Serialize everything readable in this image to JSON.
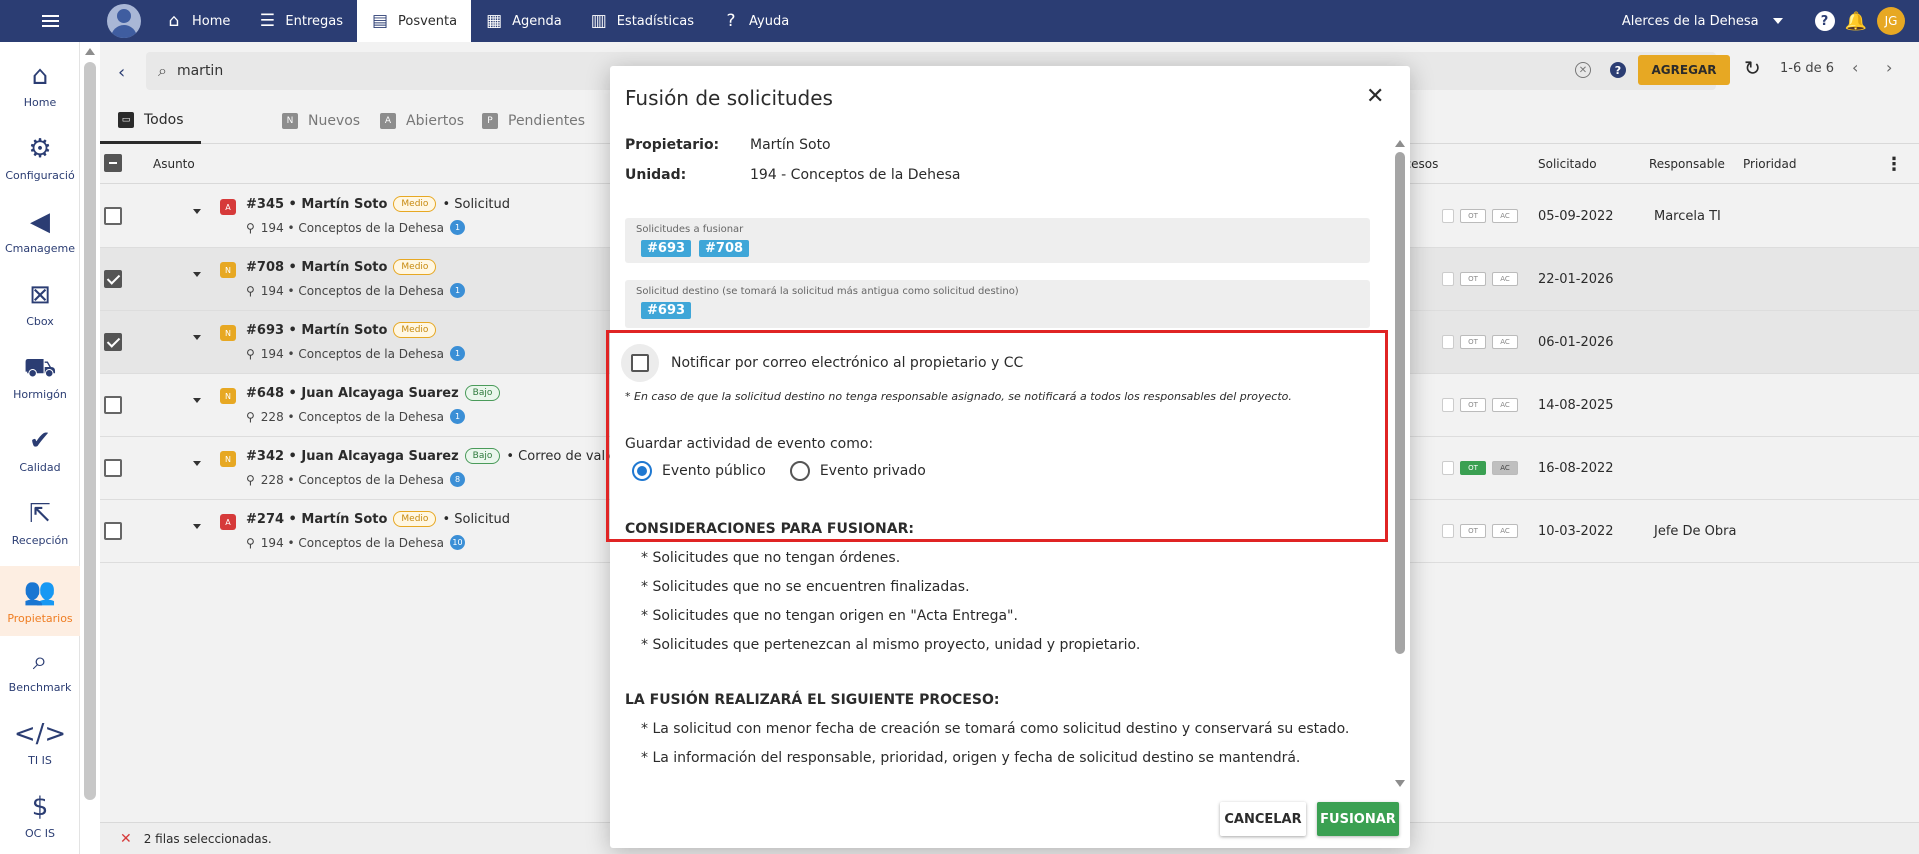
{
  "topnav": {
    "items": [
      {
        "label": "Home",
        "icon": "home-icon"
      },
      {
        "label": "Entregas",
        "icon": "list-icon"
      },
      {
        "label": "Posventa",
        "icon": "document-icon",
        "active": true
      },
      {
        "label": "Agenda",
        "icon": "calendar-icon"
      },
      {
        "label": "Estadísticas",
        "icon": "chart-icon"
      },
      {
        "label": "Ayuda",
        "icon": "help-icon"
      }
    ],
    "project": "Alerces de la Dehesa",
    "user_initials": "JG"
  },
  "sidebar": {
    "items": [
      {
        "label": "Home"
      },
      {
        "label": "Configuració"
      },
      {
        "label": "Cmanageme"
      },
      {
        "label": "Cbox"
      },
      {
        "label": "Hormigón"
      },
      {
        "label": "Calidad"
      },
      {
        "label": "Recepción"
      },
      {
        "label": "Propietarios",
        "active": true
      },
      {
        "label": "Benchmark"
      },
      {
        "label": "TI IS"
      },
      {
        "label": "OC IS"
      }
    ]
  },
  "search": {
    "value": "martin"
  },
  "toolbar": {
    "add_label": "AGREGAR",
    "pager": "1-6 de 6"
  },
  "tabs": [
    {
      "label": "Todos",
      "badge": ""
    },
    {
      "label": "Nuevos",
      "badge": "N"
    },
    {
      "label": "Abiertos",
      "badge": "A"
    },
    {
      "label": "Pendientes",
      "badge": "P"
    }
  ],
  "table": {
    "headers": {
      "asunto": "Asunto",
      "estado": "ado de procesos",
      "solicitado": "Solicitado",
      "responsable": "Responsable",
      "prioridad": "Prioridad"
    },
    "rows": [
      {
        "prio": "A",
        "prio_color": "#d63a3a",
        "title": "#345 • Martín Soto",
        "level": "Medio",
        "extra": "• Solicitud",
        "unit": "194 • Conceptos de la Dehesa",
        "count": "1",
        "date": "05-09-2022",
        "resp": "Marcela TI",
        "checked": false
      },
      {
        "prio": "N",
        "prio_color": "#e7a823",
        "title": "#708 • Martín Soto",
        "level": "Medio",
        "extra": "",
        "unit": "194 • Conceptos de la Dehesa",
        "count": "1",
        "date": "22-01-2026",
        "resp": "",
        "checked": true
      },
      {
        "prio": "N",
        "prio_color": "#e7a823",
        "title": "#693 • Martín Soto",
        "level": "Medio",
        "extra": "",
        "unit": "194 • Conceptos de la Dehesa",
        "count": "1",
        "date": "06-01-2026",
        "resp": "",
        "checked": true
      },
      {
        "prio": "N",
        "prio_color": "#e7a823",
        "title": "#648 • Juan Alcayaga Suarez",
        "level": "Bajo",
        "extra": "",
        "unit": "228 • Conceptos de la Dehesa",
        "count": "1",
        "date": "14-08-2025",
        "resp": "",
        "checked": false
      },
      {
        "prio": "N",
        "prio_color": "#e7a823",
        "title": "#342 • Juan Alcayaga Suarez",
        "level": "Bajo",
        "extra": "• Correo de valid",
        "unit": "228 • Conceptos de la Dehesa",
        "count": "8",
        "date": "16-08-2022",
        "resp": "",
        "checked": false
      },
      {
        "prio": "A",
        "prio_color": "#d63a3a",
        "title": "#274 • Martín Soto",
        "level": "Medio",
        "extra": "• Solicitud",
        "unit": "194 • Conceptos de la Dehesa",
        "count": "10",
        "date": "10-03-2022",
        "resp": "Jefe De Obra",
        "checked": false
      }
    ],
    "tag_labels": {
      "ot": "OT",
      "ac": "AC"
    }
  },
  "footer": {
    "selected": "2 filas seleccionadas."
  },
  "modal": {
    "title": "Fusión de solicitudes",
    "owner_label": "Propietario:",
    "owner_value": "Martín Soto",
    "unit_label": "Unidad:",
    "unit_value": "194 - Conceptos de la Dehesa",
    "merge_label": "Solicitudes a fusionar",
    "merge_chips": [
      "#693",
      "#708"
    ],
    "dest_label": "Solicitud destino (se tomará la solicitud más antigua como solicitud destino)",
    "dest_chip": "#693",
    "notify_label": "Notificar por correo electrónico al propietario y CC",
    "notify_note": "* En caso de que la solicitud destino no tenga responsable asignado, se notificará a todos los responsables del proyecto.",
    "save_as_label": "Guardar actividad de evento como:",
    "radio_public": "Evento público",
    "radio_private": "Evento privado",
    "considerations_title": "CONSIDERACIONES PARA FUSIONAR:",
    "considerations": [
      "* Solicitudes que no tengan órdenes.",
      "* Solicitudes que no se encuentren finalizadas.",
      "* Solicitudes que no tengan origen en \"Acta Entrega\".",
      "* Solicitudes que pertenezcan al mismo proyecto, unidad y propietario."
    ],
    "process_title": "LA FUSIÓN REALIZARÁ EL SIGUIENTE PROCESO:",
    "process": [
      "* La solicitud con menor fecha de creación se tomará como solicitud destino y conservará su estado.",
      "* La información del responsable, prioridad, origen y fecha de solicitud destino se mantendrá."
    ],
    "cancel_label": "CANCELAR",
    "merge_button_label": "FUSIONAR"
  },
  "colors": {
    "nav": "#2b3d73",
    "accent": "#e7a823",
    "success": "#3aa052",
    "chip": "#3fa6d8",
    "highlight": "#e02424"
  }
}
